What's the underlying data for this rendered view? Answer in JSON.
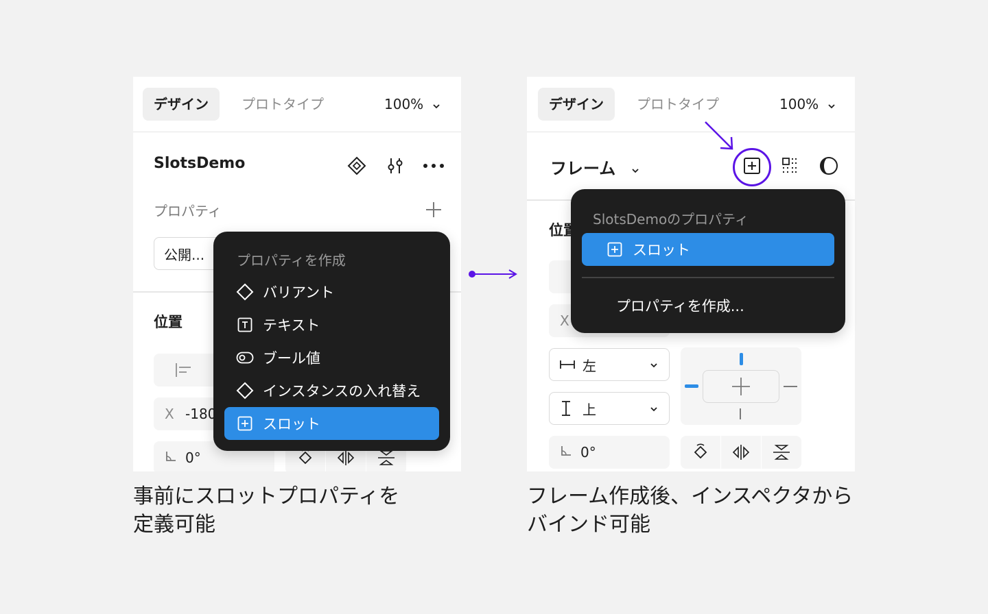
{
  "left": {
    "tabs": {
      "design": "デザイン",
      "prototype": "プロトタイプ",
      "zoom": "100%"
    },
    "component_name": "SlotsDemo",
    "properties_label": "プロパティ",
    "visibility_field": "公開...",
    "position_label": "位置",
    "x_label": "X",
    "x_value": "-180",
    "rotation_value": "0°",
    "menu": {
      "header": "プロパティを作成",
      "items": [
        {
          "label": "バリアント",
          "icon": "diamond-icon"
        },
        {
          "label": "テキスト",
          "icon": "text-box-icon"
        },
        {
          "label": "ブール値",
          "icon": "toggle-icon"
        },
        {
          "label": "インスタンスの入れ替え",
          "icon": "diamond-icon"
        },
        {
          "label": "スロット",
          "icon": "plus-square-icon",
          "selected": true
        }
      ]
    },
    "caption": [
      "事前にスロットプロパティを",
      "定義可能"
    ]
  },
  "right": {
    "tabs": {
      "design": "デザイン",
      "prototype": "プロトタイプ",
      "zoom": "100%"
    },
    "frame_label": "フレーム",
    "position_label": "位置",
    "x_label": "X",
    "horizontal_constraint": "左",
    "vertical_constraint": "上",
    "rotation_value": "0°",
    "menu": {
      "header": "SlotsDemoのプロパティ",
      "slot_item": "スロット",
      "create_item": "プロパティを作成..."
    },
    "caption": [
      "フレーム作成後、インスペクタから",
      "バインド可能"
    ]
  },
  "colors": {
    "accent": "#2d8de6",
    "highlight": "#5b14e6",
    "menu_bg": "#1e1e1e"
  }
}
